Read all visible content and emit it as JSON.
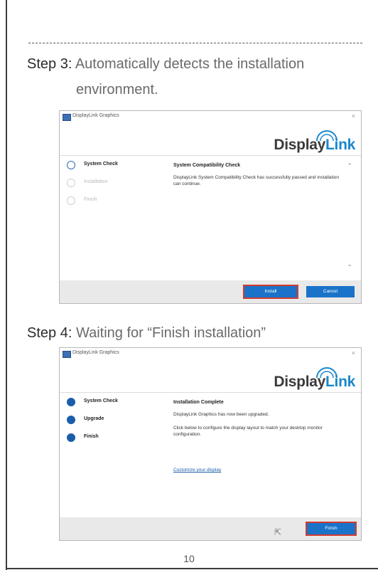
{
  "step3": {
    "label": "Step 3:",
    "text": "Automatically detects the installation",
    "text_cont": "environment."
  },
  "step4": {
    "label": "Step 4:",
    "text": "Waiting for “Finish installation”"
  },
  "window1": {
    "title": "DisplayLink Graphics",
    "close": "×",
    "logo_dark": "Display",
    "logo_blue": "Link",
    "steps": [
      {
        "label": "System Check",
        "state": "active"
      },
      {
        "label": "Installation",
        "state": "pending"
      },
      {
        "label": "Finish",
        "state": "pending"
      }
    ],
    "content_title": "System Compatibility Check",
    "content_body": "DisplayLink System Compatibility Check has successfully passed and installation can continue.",
    "install_button": "Install",
    "cancel_button": "Cancel"
  },
  "window2": {
    "title": "DisplayLink Graphics",
    "close": "×",
    "logo_dark": "Display",
    "logo_blue": "Link",
    "steps": [
      {
        "label": "System Check",
        "state": "done"
      },
      {
        "label": "Upgrade",
        "state": "done"
      },
      {
        "label": "Finish",
        "state": "done"
      }
    ],
    "content_title": "Installation Complete",
    "content_body": "DisplayLink Graphics has now been upgraded.",
    "content_body2": "Click below to configure the display layout to match your desktop monitor configuration.",
    "link": "Customize your display",
    "finish_button": "Finish"
  },
  "page_number": "10",
  "colors": {
    "accent": "#1a73c9",
    "logo_blue": "#1a87cc",
    "highlight": "#d23a2f"
  }
}
